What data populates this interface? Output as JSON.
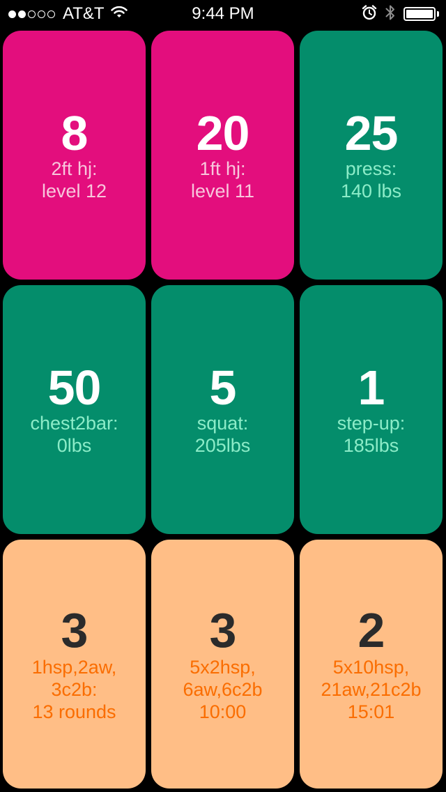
{
  "status_bar": {
    "signal_bars_filled": 2,
    "signal_bars_total": 5,
    "carrier": "AT&T",
    "wifi_icon": "wifi-icon",
    "time": "9:44 PM",
    "alarm_icon": "alarm-clock-icon",
    "bluetooth_icon": "bluetooth-icon",
    "battery_level": 1.0
  },
  "colors": {
    "pink": "#e30e7d",
    "green": "#048d6b",
    "orange": "#ffbe86"
  },
  "tiles": [
    {
      "count": "8",
      "desc": "2ft hj:\nlevel 12",
      "color": "pink"
    },
    {
      "count": "20",
      "desc": "1ft hj:\nlevel 11",
      "color": "pink"
    },
    {
      "count": "25",
      "desc": "press:\n140 lbs",
      "color": "green"
    },
    {
      "count": "50",
      "desc": "chest2bar:\n0lbs",
      "color": "green"
    },
    {
      "count": "5",
      "desc": "squat:\n205lbs",
      "color": "green"
    },
    {
      "count": "1",
      "desc": "step-up:\n185lbs",
      "color": "green"
    },
    {
      "count": "3",
      "desc": "1hsp,2aw,\n3c2b:\n13 rounds",
      "color": "orange"
    },
    {
      "count": "3",
      "desc": "5x2hsp,\n6aw,6c2b\n10:00",
      "color": "orange"
    },
    {
      "count": "2",
      "desc": "5x10hsp,\n21aw,21c2b\n15:01",
      "color": "orange"
    }
  ]
}
